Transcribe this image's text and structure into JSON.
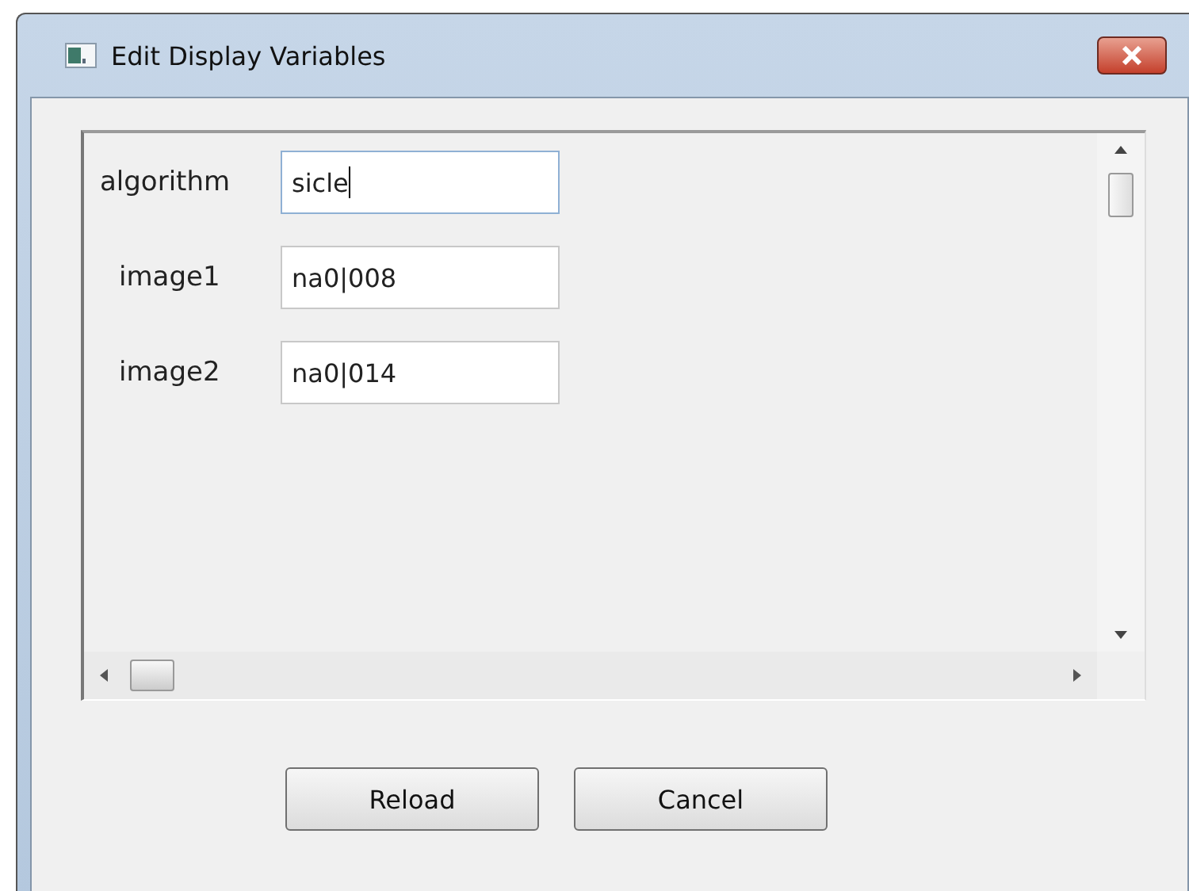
{
  "window": {
    "title": "Edit Display Variables"
  },
  "variables": [
    {
      "label": "algorithm",
      "value": "sicle",
      "focused": true
    },
    {
      "label": "image1",
      "value": "na0|008",
      "focused": false
    },
    {
      "label": "image2",
      "value": "na0|014",
      "focused": false
    }
  ],
  "buttons": [
    "Reload",
    "Cancel"
  ]
}
